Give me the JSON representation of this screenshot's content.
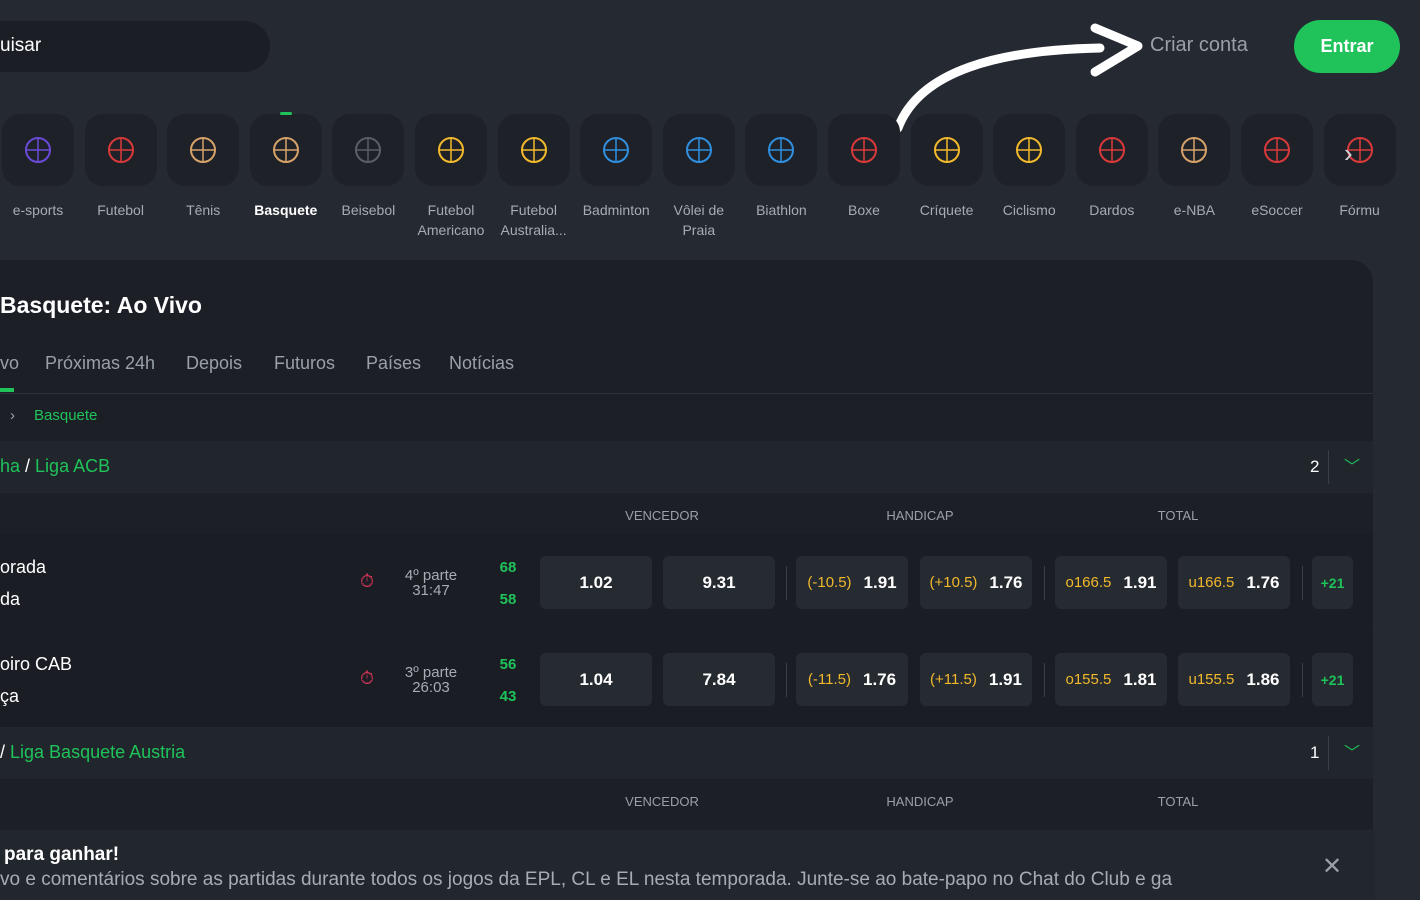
{
  "header": {
    "search_text": "uisar",
    "create_account": "Criar conta",
    "login": "Entrar"
  },
  "sports": [
    {
      "label": "e-sports",
      "icon": "gamepad-icon",
      "color": "#6a4bd8"
    },
    {
      "label": "Futebol",
      "icon": "soccer-ball-icon",
      "color": "#d83a3a"
    },
    {
      "label": "Tênis",
      "icon": "tennis-ball-icon",
      "color": "#d7a26a"
    },
    {
      "label": "Basquete",
      "icon": "basketball-icon",
      "color": "#d7a26a",
      "active": true
    },
    {
      "label": "Beisebol",
      "icon": "baseball-icon",
      "color": "#5a5e66"
    },
    {
      "label": "Futebol Americano",
      "icon": "american-football-icon",
      "color": "#f2b92c"
    },
    {
      "label": "Futebol Australia...",
      "icon": "rugby-ball-icon",
      "color": "#f2b92c"
    },
    {
      "label": "Badminton",
      "icon": "badminton-icon",
      "color": "#2f8fe0"
    },
    {
      "label": "Vôlei de Praia",
      "icon": "volleyball-icon",
      "color": "#2f8fe0"
    },
    {
      "label": "Biathlon",
      "icon": "biathlon-icon",
      "color": "#2f8fe0"
    },
    {
      "label": "Boxe",
      "icon": "boxing-glove-icon",
      "color": "#d83a3a"
    },
    {
      "label": "Críquete",
      "icon": "cricket-icon",
      "color": "#f2b92c"
    },
    {
      "label": "Ciclismo",
      "icon": "cycling-icon",
      "color": "#f2b92c"
    },
    {
      "label": "Dardos",
      "icon": "dart-icon",
      "color": "#d83a3a"
    },
    {
      "label": "e-NBA",
      "icon": "basketball-icon",
      "color": "#d7a26a"
    },
    {
      "label": "eSoccer",
      "icon": "soccer-ball-icon",
      "color": "#d83a3a"
    },
    {
      "label": "Fórmu",
      "icon": "formula-icon",
      "color": "#d83a3a"
    }
  ],
  "main": {
    "title": "Basquete: Ao Vivo",
    "tabs": [
      "vo",
      "Próximas 24h",
      "Depois",
      "Futuros",
      "Países",
      "Notícias"
    ],
    "breadcrumb": "Basquete",
    "leagues": [
      {
        "country": "ha",
        "name": "Liga ACB",
        "count": "2",
        "cols": [
          "VENCEDOR",
          "HANDICAP",
          "TOTAL"
        ],
        "matches": [
          {
            "team1": "orada",
            "team2": "da",
            "period": "4º parte",
            "time": "31:47",
            "score1": "68",
            "score2": "58",
            "win": [
              "1.02",
              "9.31"
            ],
            "hcp": [
              [
                "(-10.5)",
                "1.91"
              ],
              [
                "(+10.5)",
                "1.76"
              ]
            ],
            "tot": [
              [
                "o166.5",
                "1.91"
              ],
              [
                "u166.5",
                "1.76"
              ]
            ],
            "more": "+21"
          },
          {
            "team1": "oiro CAB",
            "team2": "ça",
            "period": "3º parte",
            "time": "26:03",
            "score1": "56",
            "score2": "43",
            "win": [
              "1.04",
              "7.84"
            ],
            "hcp": [
              [
                "(-11.5)",
                "1.76"
              ],
              [
                "(+11.5)",
                "1.91"
              ]
            ],
            "tot": [
              [
                "o155.5",
                "1.81"
              ],
              [
                "u155.5",
                "1.86"
              ]
            ],
            "more": "+21"
          }
        ]
      },
      {
        "country": "",
        "name": "Liga Basquete Austria",
        "count": "1",
        "cols": [
          "VENCEDOR",
          "HANDICAP",
          "TOTAL"
        ]
      }
    ]
  },
  "banner": {
    "title": "para ganhar!",
    "text": "vo e comentários sobre as partidas durante todos os jogos da EPL, CL e EL nesta temporada. Junte-se ao bate-papo no Chat do Club e ga"
  },
  "colors": {
    "accent": "#1fc35a",
    "handicap": "#f2b92c",
    "live": "#d8365a"
  }
}
